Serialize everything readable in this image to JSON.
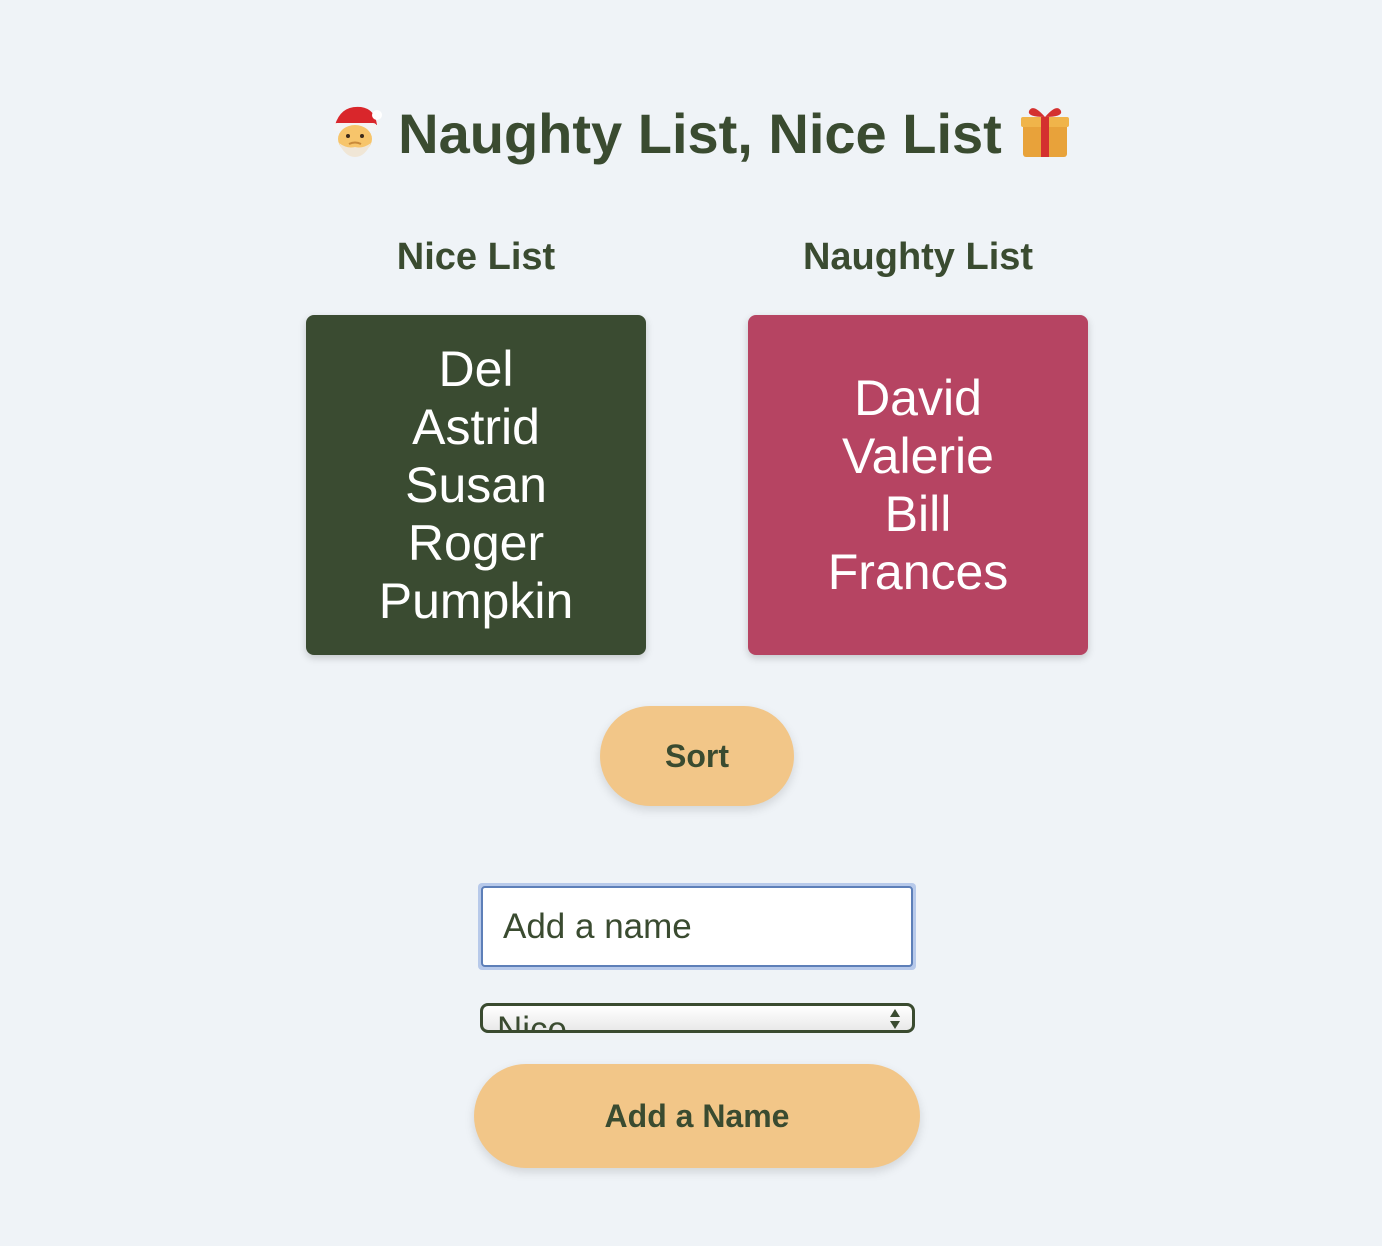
{
  "header": {
    "title": "Naughty List, Nice List",
    "left_icon": "santa-icon",
    "right_icon": "gift-icon"
  },
  "nice": {
    "heading": "Nice List",
    "names": [
      "Del",
      "Astrid",
      "Susan",
      "Roger",
      "Pumpkin"
    ],
    "color": "#3a4b31"
  },
  "naughty": {
    "heading": "Naughty List",
    "names": [
      "David",
      "Valerie",
      "Bill",
      "Frances"
    ],
    "color": "#b64462"
  },
  "controls": {
    "sort_label": "Sort",
    "name_placeholder": "Add a name",
    "list_select_value": "Nice",
    "add_label": "Add a Name",
    "button_color": "#f2c688"
  }
}
